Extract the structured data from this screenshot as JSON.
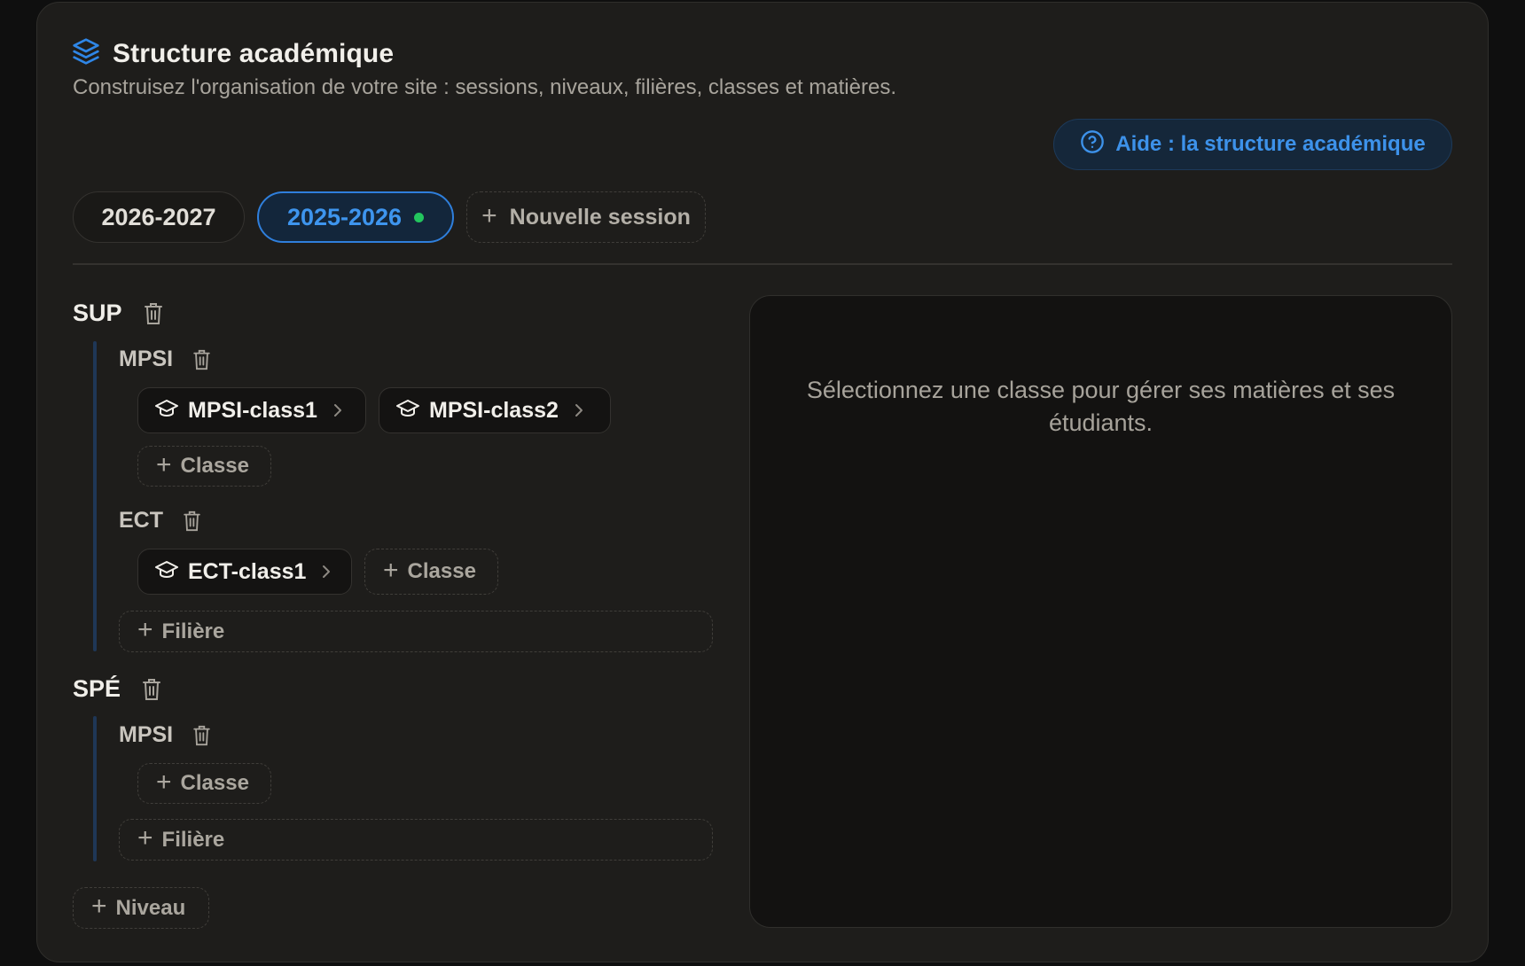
{
  "header": {
    "title": "Structure académique",
    "subtitle": "Construisez l'organisation de votre site : sessions, niveaux, filières, classes et matières.",
    "help_label": "Aide : la structure académique"
  },
  "sessions": [
    {
      "label": "2026-2027",
      "selected": false
    },
    {
      "label": "2025-2026",
      "selected": true,
      "active": true
    },
    {
      "label": "Nouvelle session"
    }
  ],
  "levels": [
    {
      "name": "SUP",
      "filieres": [
        {
          "name": "MPSI",
          "classes": [
            "MPSI-class1",
            "MPSI-class2"
          ],
          "add_class_label": "Classe"
        },
        {
          "name": "ECT",
          "classes": [
            "ECT-class1"
          ],
          "add_class_label": "Classe"
        }
      ],
      "add_filiere_label": "Filière"
    },
    {
      "name": "SPÉ",
      "filieres": [
        {
          "name": "MPSI",
          "classes": [],
          "add_class_label": "Classe"
        }
      ],
      "add_filiere_label": "Filière"
    }
  ],
  "add_level_label": "Niveau",
  "detail_panel": {
    "placeholder": "Sélectionnez une classe pour gérer ses matières et ses étudiants."
  },
  "colors": {
    "accent": "#3e95ee",
    "active_dot": "#23c55e",
    "card_bg": "#1e1d1b"
  }
}
